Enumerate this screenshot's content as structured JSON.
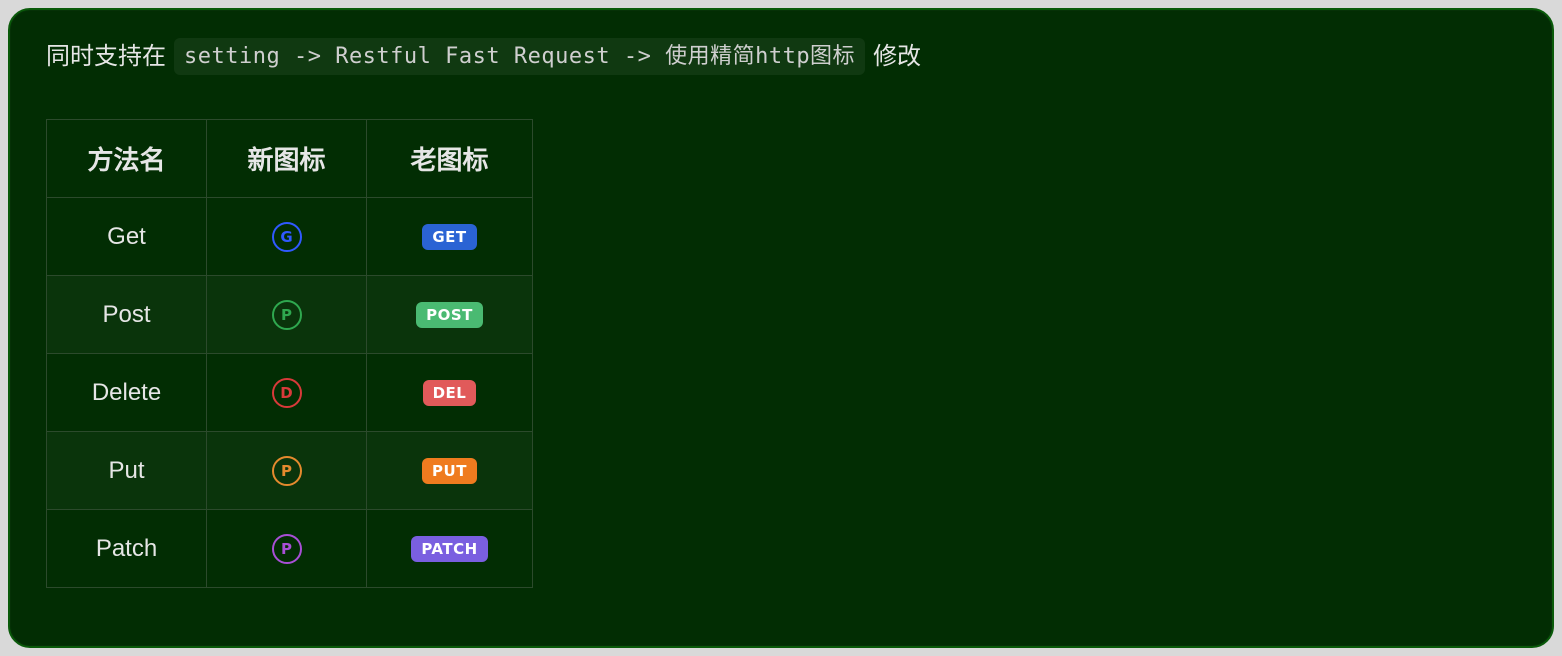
{
  "intro": {
    "prefix": "同时支持在",
    "code": "setting -> Restful Fast Request -> 使用精简http图标",
    "suffix": "修改"
  },
  "table": {
    "headers": {
      "method": "方法名",
      "newIcon": "新图标",
      "oldIcon": "老图标"
    },
    "rows": [
      {
        "name": "Get",
        "circLetter": "G",
        "circClass": "circ-G",
        "badge": "GET",
        "badgeClass": "badge-GET",
        "alt": false
      },
      {
        "name": "Post",
        "circLetter": "P",
        "circClass": "circ-P-green",
        "badge": "POST",
        "badgeClass": "badge-POST",
        "alt": true
      },
      {
        "name": "Delete",
        "circLetter": "D",
        "circClass": "circ-D",
        "badge": "DEL",
        "badgeClass": "badge-DEL",
        "alt": false
      },
      {
        "name": "Put",
        "circLetter": "P",
        "circClass": "circ-P-orange",
        "badge": "PUT",
        "badgeClass": "badge-PUT",
        "alt": true
      },
      {
        "name": "Patch",
        "circLetter": "P",
        "circClass": "circ-P-purple",
        "badge": "PATCH",
        "badgeClass": "badge-PATCH",
        "alt": false
      }
    ]
  }
}
